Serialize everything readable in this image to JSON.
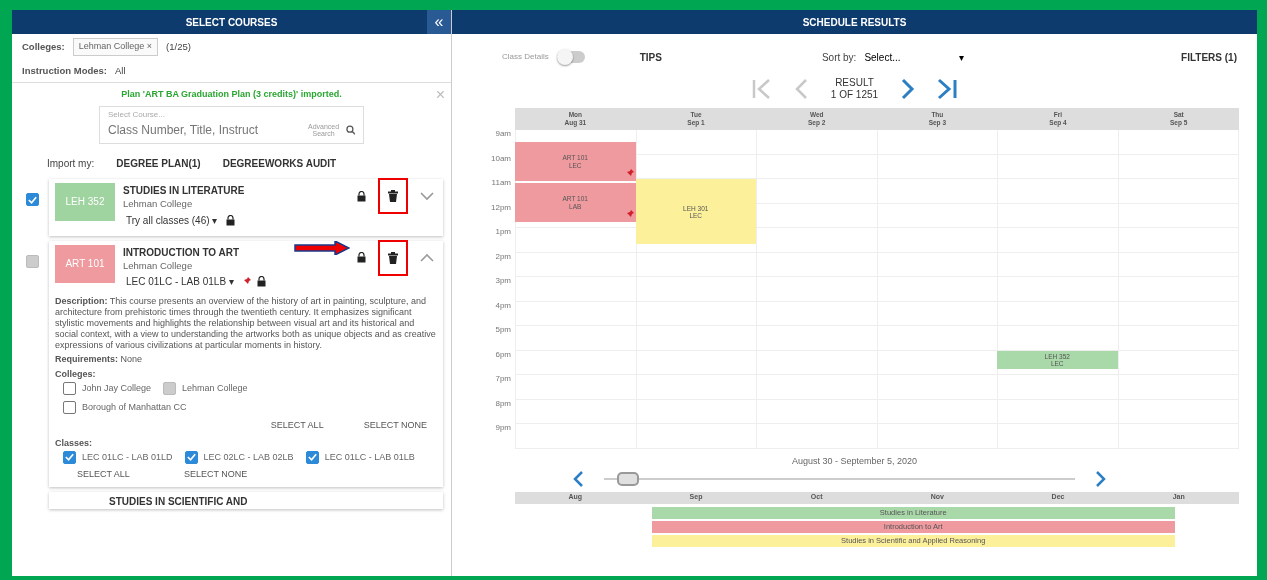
{
  "left_panel": {
    "title": "SELECT COURSES",
    "collapse_button": "«",
    "filters": [
      {
        "label": "Colleges:",
        "chips": [
          "Lehman College"
        ],
        "chip_close": "×",
        "count": "(1/25)"
      },
      {
        "label": "Instruction Modes:",
        "value": "All"
      }
    ],
    "notice": {
      "text": "Plan 'ART BA Graduation Plan (3 credits)' imported.",
      "close": "×"
    },
    "search": {
      "label": "Select Course...",
      "placeholder": "Class Number, Title, Instruct",
      "advanced": "Advanced Search"
    },
    "import": {
      "label": "Import my:",
      "buttons": [
        "DEGREE PLAN(1)",
        "DEGREEWORKS AUDIT"
      ]
    },
    "courses": [
      {
        "code": "LEH 352",
        "color": "#9fd3a0",
        "title": "STUDIES IN LITERATURE",
        "college": "Lehman College",
        "section": "Try all classes (46) ▾",
        "pinned": false,
        "checked": true,
        "disabled": false,
        "expanded": false
      },
      {
        "code": "ART 101",
        "color": "#ee9a9e",
        "title": "INTRODUCTION TO ART",
        "college": "Lehman College",
        "section": "LEC 01LC - LAB 01LB ▾",
        "pinned": true,
        "checked": true,
        "disabled": true,
        "expanded": true,
        "description": "**Description:** This course presents an overview of the history of art in painting, sculpture, and architecture from prehistoric times through the twentieth century. It emphasizes significant stylistic movements and highlights the relationship between visual art and its historical and social context, with a view to understanding the artworks both as unique objects and as creative expressions of various civilizations at particular moments in history.",
        "requirements": "**Requirements:** None",
        "colleges_label": "Colleges:",
        "colleges": [
          {
            "label": "John Jay College",
            "checked": false
          },
          {
            "label": "Lehman College",
            "checked": true,
            "disabled": true
          },
          {
            "label": "Borough of Manhattan CC",
            "checked": false
          }
        ],
        "college_actions": [
          "SELECT ALL",
          "SELECT NONE"
        ],
        "classes_label": "Classes:",
        "classes": [
          {
            "label": "LEC 01LC - LAB 01LD",
            "checked": true
          },
          {
            "label": "LEC 02LC - LAB 02LB",
            "checked": true
          },
          {
            "label": "LEC 01LC - LAB 01LB",
            "checked": true
          }
        ],
        "class_actions": [
          "SELECT ALL",
          "SELECT NONE"
        ]
      },
      {
        "title": "STUDIES IN SCIENTIFIC AND"
      }
    ]
  },
  "right_panel": {
    "title": "SCHEDULE RESULTS",
    "toolbar": {
      "toggle_label": "Class Details",
      "toggle_on": false,
      "tips": "TIPS",
      "sort_label": "Sort by:",
      "sort_value": "Select...",
      "sort_caret": "▾",
      "filters": "FILTERS (1)"
    },
    "result": {
      "label": "RESULT",
      "position": "1 OF 1251",
      "first_disabled": true,
      "prev_disabled": true,
      "next_disabled": false,
      "last_disabled": false
    },
    "days": [
      {
        "name": "Mon",
        "date": "Aug 31",
        "events": [
          {
            "title": "ART 101",
            "sub": "LEC",
            "color": "#ee9a9e",
            "pinned": true
          },
          {
            "title": "ART 101",
            "sub": "LAB",
            "color": "#ee9a9e",
            "pinned": true
          }
        ]
      },
      {
        "name": "Tue",
        "date": "Sep 1",
        "events": [
          {
            "title": "LEH 301",
            "sub": "LEC",
            "color": "#fdf09a",
            "pinned": false
          }
        ]
      },
      {
        "name": "Wed",
        "date": "Sep 2"
      },
      {
        "name": "Thu",
        "date": "Sep 3"
      },
      {
        "name": "Fri",
        "date": "Sep 4",
        "events": [
          {
            "title": "LEH 352",
            "sub": "LEC",
            "color": "#a9d8a9",
            "pinned": false
          }
        ]
      },
      {
        "name": "Sat",
        "date": "Sep 5"
      }
    ],
    "hours": [
      "9am",
      "10am",
      "11am",
      "12pm",
      "1pm",
      "2pm",
      "3pm",
      "4pm",
      "5pm",
      "6pm",
      "7pm",
      "8pm",
      "9pm"
    ],
    "range": "August 30 - September 5, 2020",
    "slider": {
      "level": 0.05
    },
    "months": [
      "Aug",
      "Sep",
      "Oct",
      "Nov",
      "Dec",
      "Jan"
    ],
    "terms": [
      {
        "name": "Studies in Literature",
        "color": "#a9d8a9"
      },
      {
        "name": "Introduction to Art",
        "color": "#ee9a9e"
      },
      {
        "name": "Studies in Scientific and Applied Reasoning",
        "color": "#fdf09a"
      }
    ]
  }
}
